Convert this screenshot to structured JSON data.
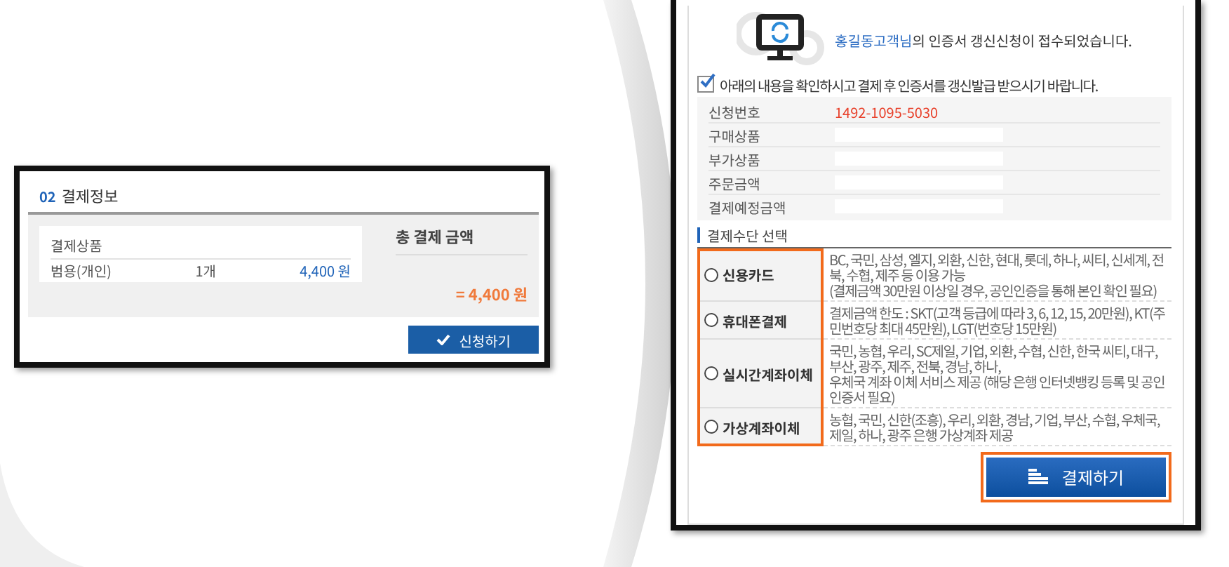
{
  "left_screen": {
    "section_number": "02",
    "section_title": "결제정보",
    "product_header": "결제상품",
    "item": {
      "name": "범용(개인)",
      "quantity": "1개",
      "price": "4,400 원"
    },
    "total_label": "총 결제 금액",
    "total_value": "= 4,400 원",
    "submit_button": "신청하기"
  },
  "right_screen": {
    "message": {
      "name": "홍길동고객님",
      "text": "의 인증서 갱신신청이 접수되었습니다."
    },
    "agreement": {
      "checked": true,
      "label": "아래의 내용을 확인하시고 결제 후 인증서를 갱신발급 받으시기 바랍니다."
    },
    "details": [
      {
        "kind": "text",
        "label": "신청번호",
        "value": "1492-1095-5030"
      },
      {
        "kind": "field",
        "label": "구매상품"
      },
      {
        "kind": "field",
        "label": "부가상품"
      },
      {
        "kind": "field",
        "label": "주문금액"
      },
      {
        "kind": "field",
        "label": "결제예정금액"
      }
    ],
    "payment_section_title": "결제수단 선택",
    "payment_methods_highlighted": true,
    "payment_methods": [
      {
        "label": "신용카드",
        "selected": false,
        "descriptions": [
          "BC, 국민, 삼성, 엘지, 외환, 신한, 현대, 롯데, 하나, 씨티, 신세계, 전북, 수협, 제주 등 이용 가능",
          "(결제금액 30만원 이상일 경우, 공인인증을 통해 본인 확인 필요)"
        ]
      },
      {
        "label": "휴대폰결제",
        "selected": false,
        "descriptions": [
          "결제금액 한도 : SKT(고객 등급에 따라 3, 6, 12, 15, 20만원), KT(주민번호당 최대 45만원), LGT(번호당 15만원)"
        ]
      },
      {
        "label": "실시간계좌이체",
        "selected": false,
        "descriptions": [
          "국민, 농협, 우리, SC제일, 기업, 외환, 수협, 신한, 한국 씨티, 대구, 부산, 광주, 제주, 전북, 경남, 하나,",
          "우체국 계좌 이체 서비스 제공 (해당 은행 인터넷뱅킹 등록 및 공인인증서 필요)"
        ]
      },
      {
        "label": "가상계좌이체",
        "selected": false,
        "descriptions": [
          "농협, 국민, 신한(조흥), 우리, 외환, 경남, 기업, 부산, 수협, 우체국, 제일, 하나, 광주 은행 가상계좌 제공"
        ]
      }
    ],
    "pay_button": {
      "label": "결제하기",
      "highlighted": true
    }
  }
}
